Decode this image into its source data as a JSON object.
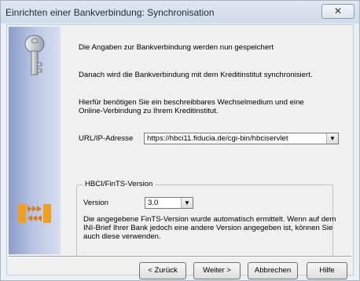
{
  "window": {
    "title": "Einrichten einer Bankverbindung: Synchronisation",
    "close_glyph": "✕"
  },
  "text": {
    "line1": "Die Angaben zur Bankverbindung werden nun gespeichert",
    "line2": "Danach wird die Bankverbindung mit dem Kreditinstitut synchronisiert.",
    "line3a": "Hierfür benötigen Sie ein beschreibbares Wechselmedium und eine",
    "line3b": "Online-Verbindung zu Ihrem Kreditinstitut."
  },
  "url": {
    "label": "URL/IP-Adresse",
    "value": "https://hbci11.fiducia.de/cgi-bin/hbciservlet"
  },
  "hbci": {
    "group_title": "HBCI/FinTS-Version",
    "version_label": "Version",
    "version_value": "3.0",
    "info_a": "Die angegebene FinTS-Version wurde automatisch ermittelt. Wenn auf dem",
    "info_b": "INI-Brief Ihrer Bank jedoch eine andere Version angegeben ist, können Sie",
    "info_c": "auch diese verwenden."
  },
  "buttons": {
    "back": "< Zurück",
    "next": "Weiter >",
    "cancel": "Abbrechen",
    "help": "Hilfe"
  },
  "icons": {
    "sidebar_top": "key-icon",
    "sidebar_bottom": "sync-arrows-icon",
    "combo_arrow": "chevron-down-icon"
  },
  "colors": {
    "sidebar": "#8a9cc9",
    "dialog_bg": "#f0f0f0"
  }
}
